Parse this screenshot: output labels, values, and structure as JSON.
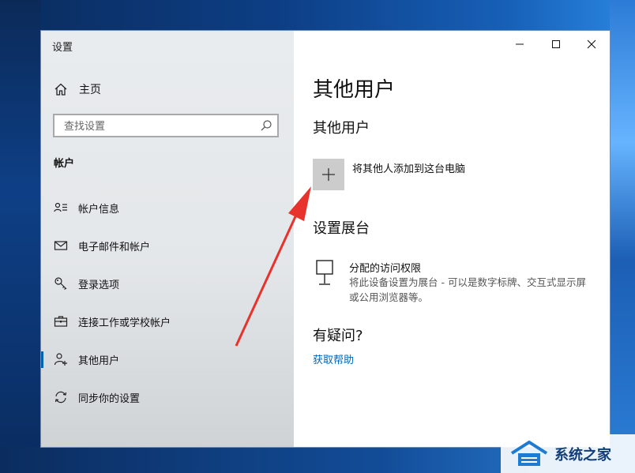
{
  "window": {
    "title": "设置"
  },
  "sidebar": {
    "home_label": "主页",
    "search_placeholder": "查找设置",
    "section_title": "帐户",
    "items": [
      {
        "label": "帐户信息",
        "icon": "account-info-icon"
      },
      {
        "label": "电子邮件和帐户",
        "icon": "email-icon"
      },
      {
        "label": "登录选项",
        "icon": "key-icon"
      },
      {
        "label": "连接工作或学校帐户",
        "icon": "briefcase-icon"
      },
      {
        "label": "其他用户",
        "icon": "person-add-icon",
        "active": true
      },
      {
        "label": "同步你的设置",
        "icon": "sync-icon"
      }
    ]
  },
  "content": {
    "page_title": "其他用户",
    "other_users_heading": "其他用户",
    "add_user_label": "将其他人添加到这台电脑",
    "kiosk_heading": "设置展台",
    "kiosk_title": "分配的访问权限",
    "kiosk_description": "将此设备设置为展台 - 可以是数字标牌、交互式显示屏或公用浏览器等。",
    "question_heading": "有疑问?",
    "help_link": "获取帮助"
  },
  "watermark": {
    "text": "系统之家"
  },
  "colors": {
    "accent": "#0063b1",
    "link": "#0067b8",
    "arrow": "#e8322c"
  }
}
